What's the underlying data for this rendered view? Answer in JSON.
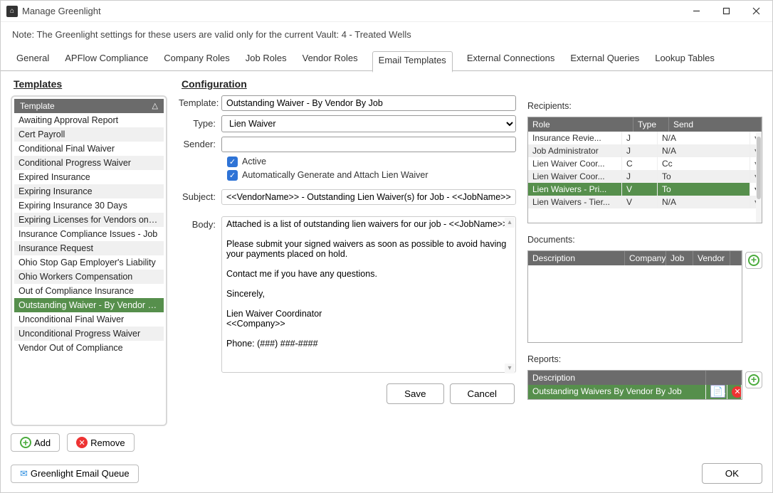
{
  "window": {
    "title": "Manage Greenlight"
  },
  "note": "Note:  The Greenlight settings for these users are valid only for the current Vault: 4 - Treated Wells",
  "tabs": [
    "General",
    "APFlow Compliance",
    "Company Roles",
    "Job Roles",
    "Vendor Roles",
    "Email Templates",
    "External Connections",
    "External Queries",
    "Lookup Tables"
  ],
  "active_tab": "Email Templates",
  "templates": {
    "heading": "Templates",
    "header_label": "Template",
    "items": [
      "Awaiting Approval Report",
      "Cert Payroll",
      "Conditional Final Waiver",
      "Conditional Progress Waiver",
      "Expired Insurance",
      "Expiring Insurance",
      "Expiring Insurance 30 Days",
      "Expiring Licenses for Vendors on th...",
      "Insurance Compliance Issues - Job",
      "Insurance Request",
      "Ohio Stop Gap Employer's Liability",
      "Ohio Workers Compensation",
      "Out of Compliance Insurance",
      "Outstanding Waiver - By Vendor By...",
      "Unconditional Final Waiver",
      "Unconditional Progress Waiver",
      "Vendor Out of Compliance"
    ],
    "selected": "Outstanding Waiver - By Vendor By...",
    "add_label": "Add",
    "remove_label": "Remove"
  },
  "config": {
    "heading": "Configuration",
    "labels": {
      "template": "Template:",
      "type": "Type:",
      "sender": "Sender:",
      "subject": "Subject:",
      "body": "Body:"
    },
    "template_value": "Outstanding Waiver - By Vendor By Job",
    "type_value": "Lien Waiver",
    "sender_value": "",
    "active_checked": true,
    "active_label": "Active",
    "auto_checked": true,
    "auto_label": "Automatically Generate and Attach Lien Waiver",
    "subject_value": "<<VendorName>> - Outstanding Lien Waiver(s) for Job - <<JobName>>",
    "body_value": "Attached is a list of outstanding lien waivers for our job - <<JobName>>.\n\nPlease submit your signed waivers as soon as possible to avoid having your payments placed on hold.\n\nContact me if you have any questions.\n\nSincerely,\n\nLien Waiver Coordinator\n<<Company>>\n\nPhone: (###) ###-####"
  },
  "recipients": {
    "label": "Recipients:",
    "headers": {
      "role": "Role",
      "type": "Type",
      "send": "Send"
    },
    "rows": [
      {
        "role": "Insurance Revie...",
        "type": "J",
        "send": "N/A",
        "sel": false
      },
      {
        "role": "Job Administrator",
        "type": "J",
        "send": "N/A",
        "sel": false
      },
      {
        "role": "Lien Waiver Coor...",
        "type": "C",
        "send": "Cc",
        "sel": false
      },
      {
        "role": "Lien Waiver Coor...",
        "type": "J",
        "send": "To",
        "sel": false
      },
      {
        "role": "Lien Waivers - Pri...",
        "type": "V",
        "send": "To",
        "sel": true
      },
      {
        "role": "Lien Waivers - Tier...",
        "type": "V",
        "send": "N/A",
        "sel": false
      }
    ]
  },
  "documents": {
    "label": "Documents:",
    "headers": {
      "desc": "Description",
      "c2": "Company",
      "c3": "Job",
      "c4": "Vendor"
    }
  },
  "reports": {
    "label": "Reports:",
    "header": "Description",
    "row": "Outstanding Waivers By Vendor By Job"
  },
  "buttons": {
    "save": "Save",
    "cancel": "Cancel",
    "ok": "OK",
    "queue": "Greenlight Email Queue"
  }
}
